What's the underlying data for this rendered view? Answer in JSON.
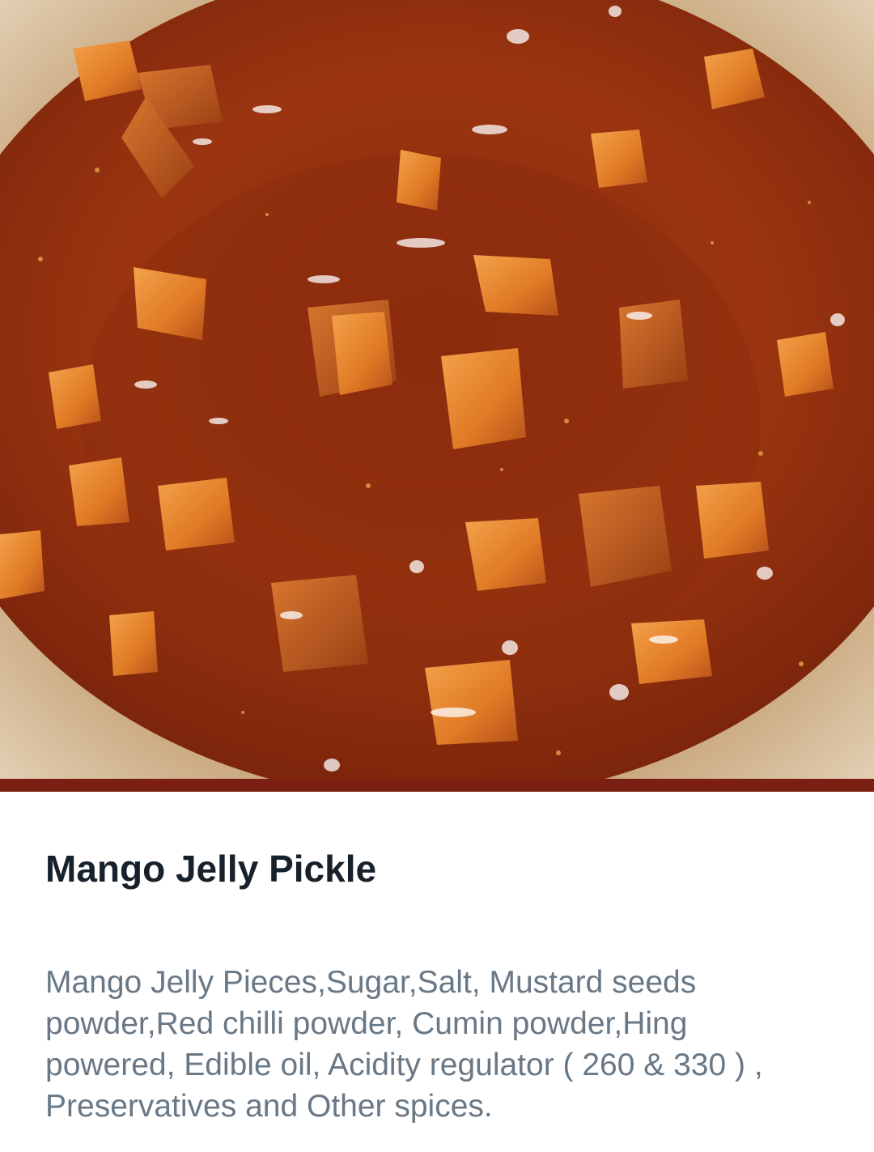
{
  "product": {
    "image_alt": "mango-jelly-pickle-photo",
    "title": "Mango Jelly Pickle",
    "description": "Mango Jelly Pieces,Sugar,Salt, Mustard seeds powder,Red chilli powder, Cumin powder,Hing powered, Edible oil, Acidity regulator ( 260 & 330 ) , Preservatives and Other spices."
  },
  "colors": {
    "accent_bar": "#7a1f12",
    "title_text": "#17212b",
    "description_text": "#697886",
    "background": "#ffffff"
  }
}
